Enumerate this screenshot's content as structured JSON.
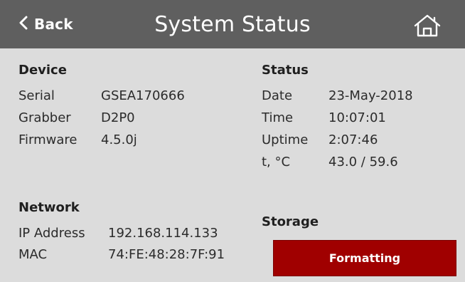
{
  "header": {
    "back_label": "Back",
    "title": "System Status",
    "home_icon": "home-icon",
    "back_icon": "chevron-left-icon"
  },
  "device": {
    "title": "Device",
    "rows": [
      {
        "label": "Serial",
        "value": "GSEA170666"
      },
      {
        "label": "Grabber",
        "value": "D2P0"
      },
      {
        "label": "Firmware",
        "value": "4.5.0j"
      }
    ]
  },
  "status": {
    "title": "Status",
    "rows": [
      {
        "label": "Date",
        "value": "23-May-2018"
      },
      {
        "label": "Time",
        "value": "10:07:01"
      },
      {
        "label": "Uptime",
        "value": "2:07:46"
      },
      {
        "label": "t, °C",
        "value": "43.0 / 59.6"
      }
    ]
  },
  "network": {
    "title": "Network",
    "rows": [
      {
        "label": "IP Address",
        "value": "192.168.114.133"
      },
      {
        "label": "MAC",
        "value": "74:FE:48:28:7F:91"
      }
    ]
  },
  "storage": {
    "title": "Storage",
    "button_label": "Formatting",
    "button_color": "#a00000"
  },
  "colors": {
    "header_bg": "#5f5f5f",
    "page_bg": "#dcdcdc"
  }
}
